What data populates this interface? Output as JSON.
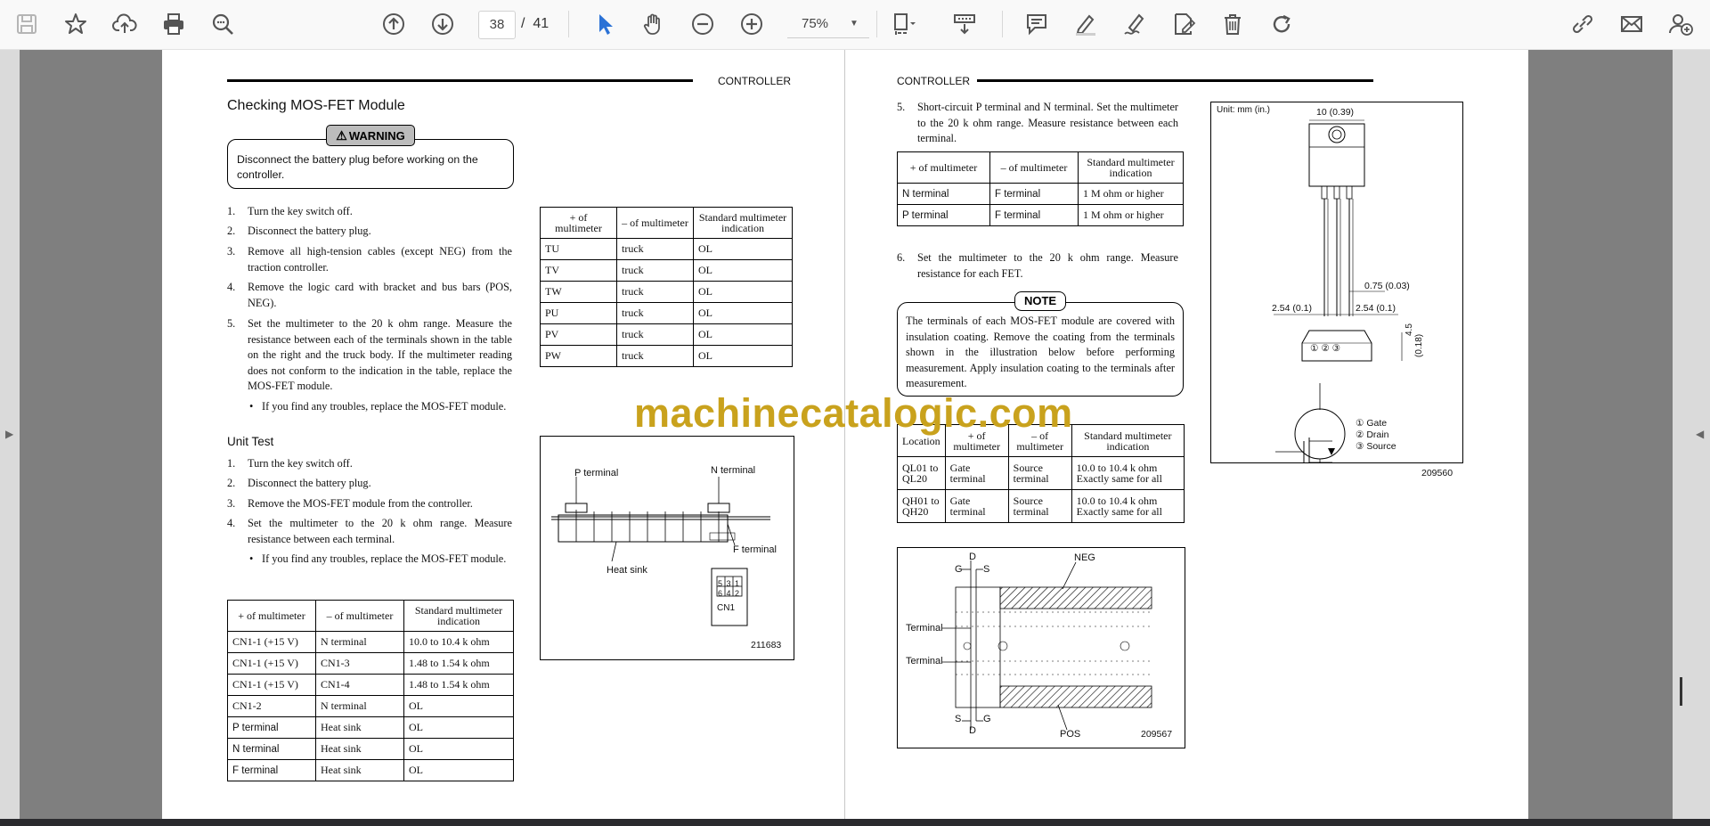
{
  "toolbar": {
    "current_page": "38",
    "page_separator": "/",
    "total_pages": "41",
    "zoom": "75%"
  },
  "left_page": {
    "header": "CONTROLLER",
    "title": "Checking MOS-FET Module",
    "warning_label": "WARNING",
    "warning_text": "Disconnect the battery plug before working on the controller.",
    "steps": [
      {
        "n": "1.",
        "t": "Turn the key switch off."
      },
      {
        "n": "2.",
        "t": "Disconnect the battery plug."
      },
      {
        "n": "3.",
        "t": "Remove all high-tension cables (except NEG) from the traction controller."
      },
      {
        "n": "4.",
        "t": "Remove the logic card with bracket and bus bars (POS, NEG)."
      },
      {
        "n": "5.",
        "t": "Set the multimeter to the 20 k ohm range.  Measure the resistance between each of the terminals shown in the table on the right and the truck body.  If the multimeter reading does not conform to the indication in the table, replace the MOS-FET module."
      }
    ],
    "bullet1": "If you find any troubles, replace the MOS-FET module.",
    "unit_test_title": "Unit Test",
    "unit_steps": [
      {
        "n": "1.",
        "t": "Turn the key switch off."
      },
      {
        "n": "2.",
        "t": "Disconnect the battery plug."
      },
      {
        "n": "3.",
        "t": "Remove the MOS-FET module from the controller."
      },
      {
        "n": "4.",
        "t": "Set the multimeter to the 20 k ohm range.  Measure resistance between each terminal."
      }
    ],
    "bullet2": "If you find any troubles, replace the MOS-FET module.",
    "table_right": {
      "headers": [
        "+ of multimeter",
        "– of multimeter",
        "Standard multimeter indication"
      ],
      "rows": [
        [
          "TU",
          "truck",
          "OL"
        ],
        [
          "TV",
          "truck",
          "OL"
        ],
        [
          "TW",
          "truck",
          "OL"
        ],
        [
          "PU",
          "truck",
          "OL"
        ],
        [
          "PV",
          "truck",
          "OL"
        ],
        [
          "PW",
          "truck",
          "OL"
        ]
      ]
    },
    "table_bottom": {
      "headers": [
        "+ of multimeter",
        "– of multimeter",
        "Standard multimeter indication"
      ],
      "rows": [
        [
          "CN1-1 (+15 V)",
          "N terminal",
          "10.0 to 10.4 k ohm"
        ],
        [
          "CN1-1 (+15 V)",
          "CN1-3",
          "1.48 to 1.54 k ohm"
        ],
        [
          "CN1-1 (+15 V)",
          "CN1-4",
          "1.48 to 1.54 k ohm"
        ],
        [
          "CN1-2",
          "N terminal",
          "OL"
        ],
        [
          "P terminal",
          "Heat sink",
          "OL"
        ],
        [
          "N terminal",
          "Heat sink",
          "OL"
        ],
        [
          "F terminal",
          "Heat sink",
          "OL"
        ]
      ]
    },
    "figure": {
      "p_terminal": "P terminal",
      "n_terminal": "N terminal",
      "f_terminal": "F terminal",
      "heat_sink": "Heat sink",
      "cn1": "CN1",
      "cn_row1": "5 3 1",
      "cn_row2": "6 4 2",
      "fig_no": "211683"
    }
  },
  "right_page": {
    "header": "CONTROLLER",
    "step5": {
      "n": "5.",
      "t": "Short-circuit P terminal and N terminal.  Set the multimeter to the 20 k ohm range.  Measure resistance between each terminal."
    },
    "table1": {
      "headers": [
        "+ of multimeter",
        "– of multimeter",
        "Standard multimeter indication"
      ],
      "rows": [
        [
          "N terminal",
          "F terminal",
          "1 M ohm or higher"
        ],
        [
          "P terminal",
          "F terminal",
          "1 M ohm or higher"
        ]
      ]
    },
    "step6": {
      "n": "6.",
      "t": "Set the multimeter to the 20 k ohm range.  Measure resistance for each FET."
    },
    "note_label": "NOTE",
    "note_text": "The terminals of each MOS-FET module are covered with insulation coating.  Remove the coating from the terminals shown in the illustration below before performing measurement.  Apply insulation coating to the terminals after measurement.",
    "table2": {
      "headers": [
        "Location",
        "+ of multimeter",
        "– of multimeter",
        "Standard multimeter indication"
      ],
      "rows": [
        [
          "QL01 to QL20",
          "Gate terminal",
          "Source terminal",
          "10.0 to 10.4 k ohm Exactly same for all"
        ],
        [
          "QH01 to QH20",
          "Gate terminal",
          "Source terminal",
          "10.0 to 10.4 k ohm Exactly same for all"
        ]
      ]
    },
    "fig_top": {
      "unit": "Unit:  mm (in.)",
      "dim_top": "10 (0.39)",
      "dim_075": "0.75 (0.03)",
      "dim_254a": "2.54 (0.1)",
      "dim_254b": "2.54 (0.1)",
      "dim_45": "4.5",
      "dim_018": "(0.18)",
      "pin_nums": "① ② ③",
      "gate": "① Gate",
      "drain": "② Drain",
      "source": "③ Source",
      "fig_no": "209560"
    },
    "fig_bottom": {
      "neg": "NEG",
      "pos": "POS",
      "terminal1": "Terminal",
      "terminal2": "Terminal",
      "d_top": "D",
      "g_top": "G",
      "s_top": "S",
      "s_bot": "S",
      "g_bot": "G",
      "d_bot": "D",
      "fig_no": "209567"
    }
  },
  "watermark": "machinecatalogic.com"
}
